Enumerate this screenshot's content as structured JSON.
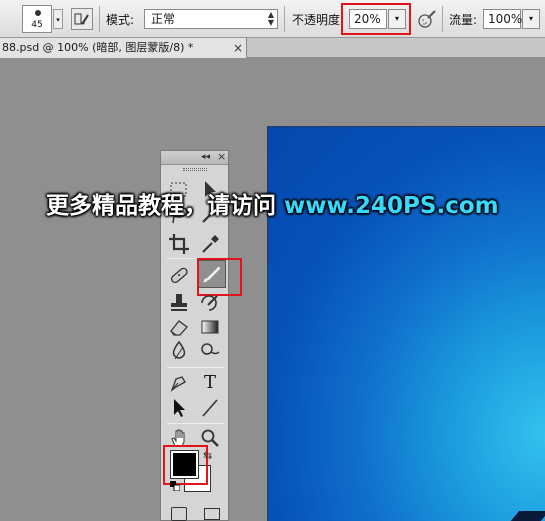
{
  "options_bar": {
    "brush_size": "45",
    "mode_label": "模式:",
    "mode_value": "正常",
    "opacity_label": "不透明度",
    "opacity_value": "20%",
    "flow_label": "流量:",
    "flow_value": "100%"
  },
  "document_tab": {
    "title": "88.psd @ 100% (暗部, 图层蒙版/8) *",
    "close": "×"
  },
  "tools_panel": {
    "collapse": "◂◂",
    "close": "×",
    "type_tool_glyph": "T",
    "selected_tool": "brush-tool",
    "foreground_color": "#000000",
    "background_color": "#ffffff"
  },
  "watermark": {
    "chinese": "更多精品教程，请访问",
    "url": "www.240PS.com"
  },
  "colors": {
    "highlight_box": "#e0141b",
    "canvas_dark": "#0548ad",
    "canvas_light": "#33c2ee",
    "workspace": "#8f8f8f"
  }
}
